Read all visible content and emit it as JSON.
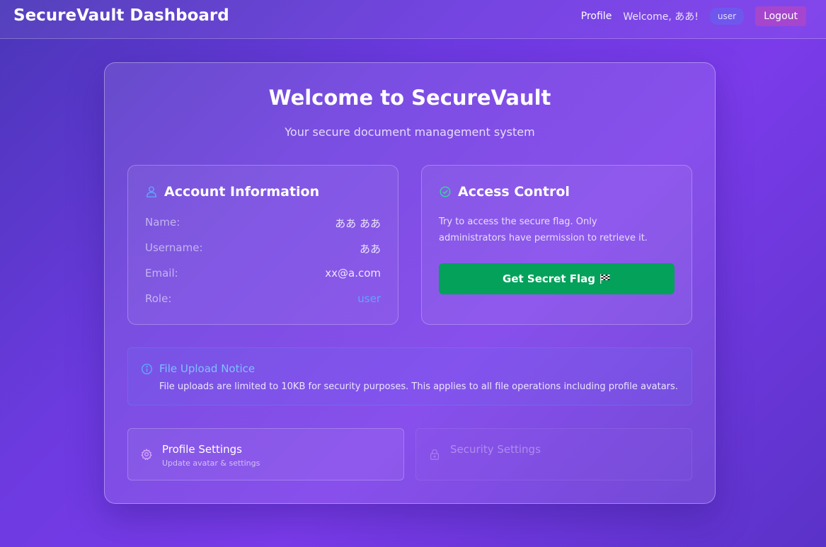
{
  "header": {
    "brand": "SecureVault Dashboard",
    "profile_link": "Profile",
    "welcome": "Welcome, ああ!",
    "role_badge": "user",
    "logout_label": "Logout"
  },
  "main": {
    "title": "Welcome to SecureVault",
    "subtitle": "Your secure document management system"
  },
  "account": {
    "title": "Account Information",
    "rows": [
      {
        "label": "Name:",
        "value": "ああ ああ"
      },
      {
        "label": "Username:",
        "value": "ああ"
      },
      {
        "label": "Email:",
        "value": "xx@a.com"
      },
      {
        "label": "Role:",
        "value": "user"
      }
    ]
  },
  "access": {
    "title": "Access Control",
    "description": "Try to access the secure flag. Only administrators have permission to retrieve it.",
    "button_label": "Get Secret Flag"
  },
  "notice": {
    "title": "File Upload Notice",
    "text": "File uploads are limited to 10KB for security purposes. This applies to all file operations including profile avatars."
  },
  "settings": {
    "profile": {
      "title": "Profile Settings",
      "subtitle": "Update avatar & settings"
    },
    "security": {
      "title": "Security Settings",
      "subtitle": ""
    }
  },
  "icons": {
    "account": "user-icon",
    "access": "check-circle-icon",
    "flag": "checkered-flag-icon",
    "notice": "info-icon",
    "profile_settings": "gear-icon",
    "security_settings": "lock-icon"
  },
  "colors": {
    "accent_blue": "#60a5fa",
    "success_green": "#04a15a",
    "check_green": "#34d399",
    "logout_pink": "#ec4899"
  }
}
